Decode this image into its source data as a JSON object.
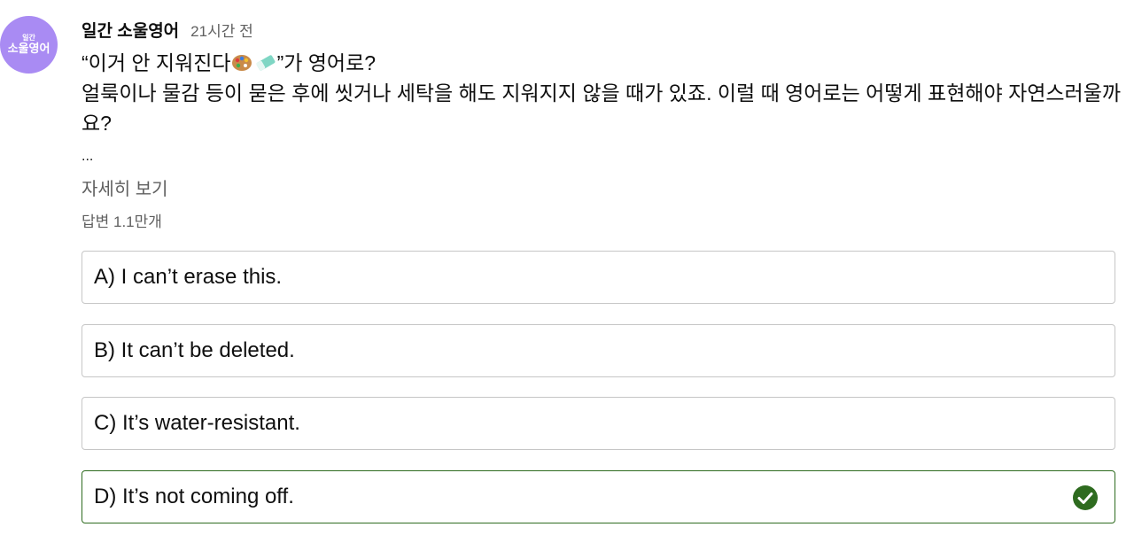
{
  "channel": {
    "avatar_line1": "일간",
    "avatar_line2": "소울영어",
    "name": "일간 소울영어",
    "timestamp": "21시간 전"
  },
  "post": {
    "text_before_emoji": "“이거 안 지워진다",
    "text_after_emoji": "”가 영어로?",
    "body": "얼룩이나 물감 등이 묻은 후에 씻거나 세탁을 해도 지워지지 않을 때가 있죠. 이럴 때 영어로는 어떻게 표현해야 자연스러울까요?",
    "ellipsis": "...",
    "read_more": "자세히 보기",
    "reply_count": "답변 1.1만개",
    "emojis": [
      "palette-icon",
      "eraser-icon"
    ]
  },
  "quiz": {
    "options": [
      {
        "label": "A) I can’t erase this.",
        "correct": false
      },
      {
        "label": "B) It can’t be deleted.",
        "correct": false
      },
      {
        "label": "C) It’s water-resistant.",
        "correct": false
      },
      {
        "label": "D) It’s not coming off.",
        "correct": true
      }
    ],
    "correct_color": "#2e6b1f"
  }
}
